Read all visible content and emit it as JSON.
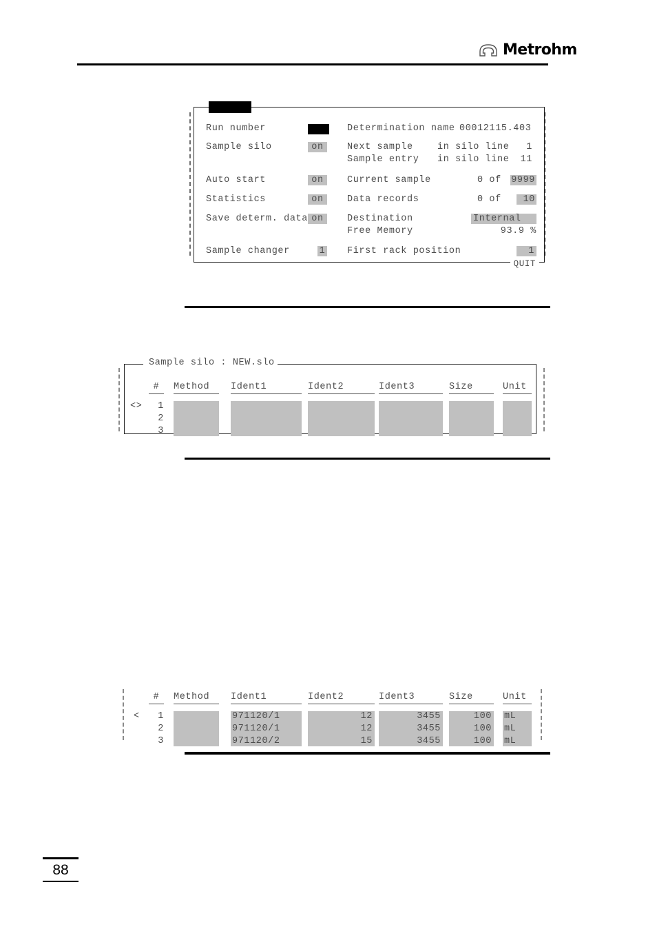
{
  "header": {
    "brand_name": "Metrohm",
    "brand_icon": "omega-logo-icon"
  },
  "page": {
    "number": "88"
  },
  "run_panel": {
    "title_redacted": "",
    "quit_label": "QUIT",
    "rows": [
      {
        "label": "Run number",
        "value": "",
        "value_style": "black",
        "right_label": "Determination name",
        "right_value": "00012115.403",
        "right_style": "plain"
      },
      {
        "label": "Sample silo",
        "value": "on",
        "value_style": "gray",
        "right_label": "Next sample",
        "right_mid": "in silo line",
        "right_value": "1",
        "right_style": "plain"
      },
      {
        "label": "",
        "value": "",
        "value_style": "none",
        "right_label": "Sample entry",
        "right_mid": "in silo line",
        "right_value": "11",
        "right_style": "plain"
      },
      {
        "label": "Auto start",
        "value": "on",
        "value_style": "gray",
        "right_label": "Current sample",
        "right_mid": "0 of",
        "right_value": "9999",
        "right_style": "gray"
      },
      {
        "label": "Statistics",
        "value": "on",
        "value_style": "gray",
        "right_label": "Data records",
        "right_mid": "0 of",
        "right_value": "10",
        "right_style": "gray"
      },
      {
        "label": "Save determ. data",
        "value": "on",
        "value_style": "gray",
        "right_label": "Destination",
        "right_mid": "",
        "right_value": "Internal",
        "right_style": "gray"
      },
      {
        "label": "",
        "value": "",
        "value_style": "none",
        "right_label": "Free Memory",
        "right_mid": "",
        "right_value": "93.9 %",
        "right_style": "plain"
      },
      {
        "label": "Sample changer",
        "value": "1",
        "value_style": "gray",
        "right_label": "First rack position",
        "right_mid": "",
        "right_value": "1",
        "right_style": "gray"
      }
    ]
  },
  "silo_panel": {
    "legend": "Sample silo : NEW.slo",
    "row_marker": "<>",
    "columns": [
      "#",
      "Method",
      "Ident1",
      "Ident2",
      "Ident3",
      "Size",
      "Unit"
    ],
    "rows": [
      {
        "num": "1",
        "method": "",
        "ident1": "",
        "ident2": "",
        "ident3": "",
        "size": "",
        "unit": ""
      },
      {
        "num": "2",
        "method": "",
        "ident1": "",
        "ident2": "",
        "ident3": "",
        "size": "",
        "unit": ""
      },
      {
        "num": "3",
        "method": "",
        "ident1": "",
        "ident2": "",
        "ident3": "",
        "size": "",
        "unit": ""
      }
    ]
  },
  "data_panel": {
    "row_marker": "<",
    "columns": [
      "#",
      "Method",
      "Ident1",
      "Ident2",
      "Ident3",
      "Size",
      "Unit"
    ],
    "rows": [
      {
        "num": "1",
        "method": "",
        "ident1": "971120/1",
        "ident2": "12",
        "ident3": "3455",
        "size": "100",
        "unit": "mL"
      },
      {
        "num": "2",
        "method": "",
        "ident1": "971120/1",
        "ident2": "12",
        "ident3": "3455",
        "size": "100",
        "unit": "mL"
      },
      {
        "num": "3",
        "method": "",
        "ident1": "971120/2",
        "ident2": "15",
        "ident3": "3455",
        "size": "100",
        "unit": "mL"
      }
    ]
  },
  "colors": {
    "field_gray": "#c0c0c0",
    "text_gray": "#4d4d4d",
    "rule_black": "#000000"
  }
}
